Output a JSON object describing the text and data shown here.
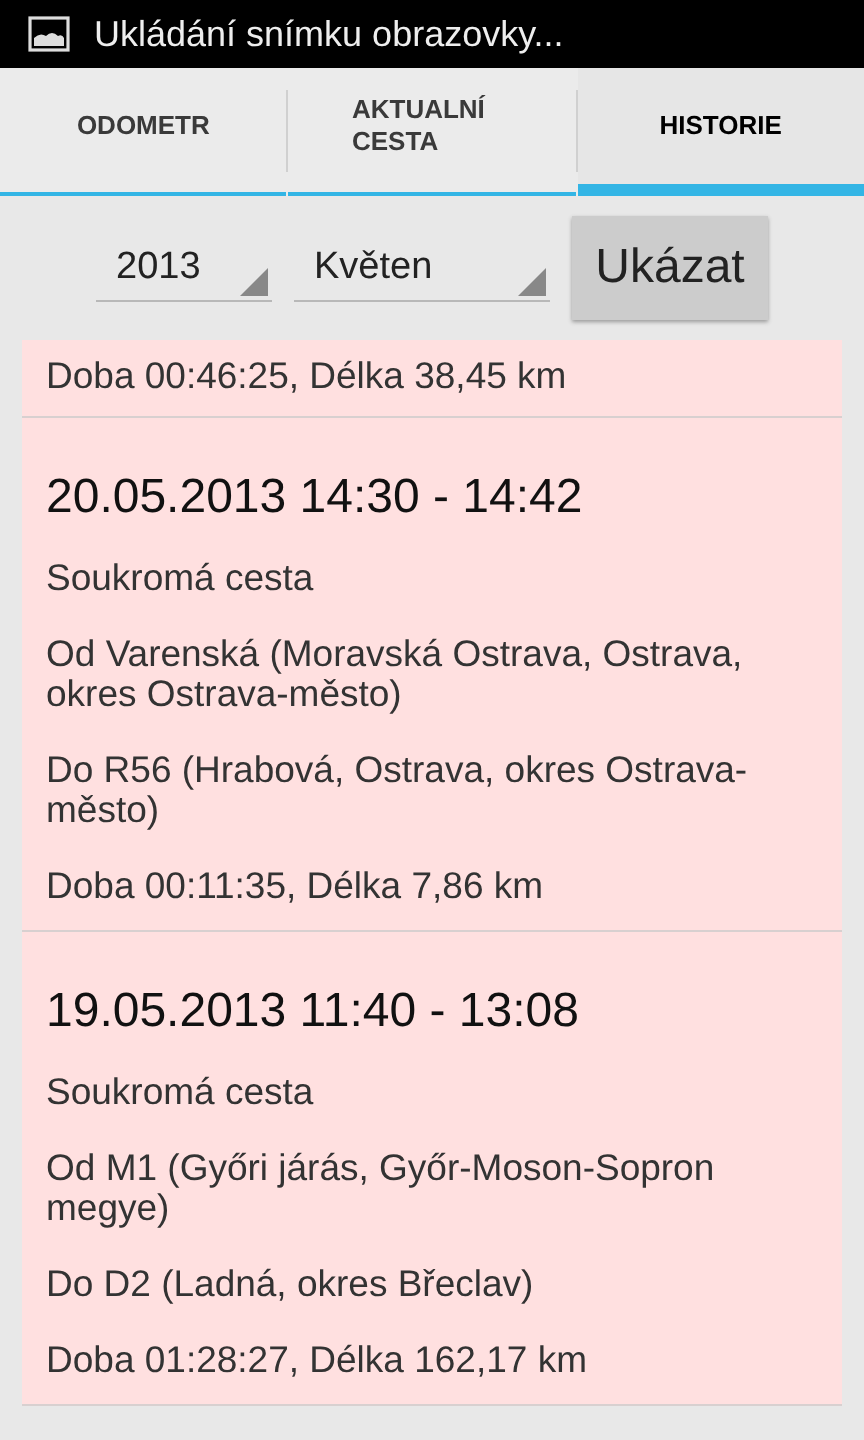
{
  "status_bar": {
    "notification": "Ukládání snímku obrazovky..."
  },
  "tabs": [
    {
      "label": "ODOMETR",
      "selected": false
    },
    {
      "label": "AKTUALNÍ CESTA",
      "selected": false
    },
    {
      "label": "HISTORIE",
      "selected": true
    }
  ],
  "filter": {
    "year": "2013",
    "month": "Květen",
    "button": "Ukázat"
  },
  "trips": [
    {
      "summary": "Doba 00:46:25, Délka 38,45 km"
    },
    {
      "title": "20.05.2013 14:30 - 14:42",
      "type": "Soukromá cesta",
      "from": "Od Varenská (Moravská Ostrava, Ostrava, okres Ostrava-město)",
      "to": "Do R56 (Hrabová, Ostrava, okres Ostrava-město)",
      "summary": "Doba 00:11:35, Délka 7,86 km"
    },
    {
      "title": "19.05.2013 11:40 - 13:08",
      "type": "Soukromá cesta",
      "from": "Od M1 (Győri járás, Győr-Moson-Sopron megye)",
      "to": "Do D2 (Ladná, okres Břeclav)",
      "summary": "Doba 01:28:27, Délka 162,17 km"
    }
  ]
}
